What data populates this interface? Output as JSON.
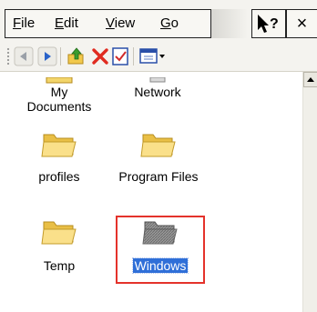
{
  "menu": {
    "file": {
      "accel": "F",
      "rest": "ile"
    },
    "edit": {
      "accel": "E",
      "rest": "dit"
    },
    "view": {
      "accel": "V",
      "rest": "iew"
    },
    "go": {
      "accel": "G",
      "rest": "o"
    },
    "close_glyph": "×"
  },
  "toolbar": {
    "buttons": [
      "back-icon",
      "forward-icon",
      "folder-up-icon",
      "delete-icon",
      "properties-icon",
      "views-icon"
    ]
  },
  "items": [
    {
      "label_line1": "My",
      "label_line2": "Documents",
      "icon": "my-documents-icon"
    },
    {
      "label_line1": "Network",
      "icon": "network-icon"
    },
    {
      "label": "profiles",
      "icon": "folder-icon"
    },
    {
      "label": "Program Files",
      "icon": "folder-icon"
    },
    {
      "label": "Temp",
      "icon": "folder-icon"
    },
    {
      "label": "Windows",
      "icon": "hidden-folder-icon",
      "selected": true
    }
  ],
  "colors": {
    "selection": "#2f6fd8",
    "highlight_frame": "#e4322b",
    "folder": "#f6d86b"
  }
}
